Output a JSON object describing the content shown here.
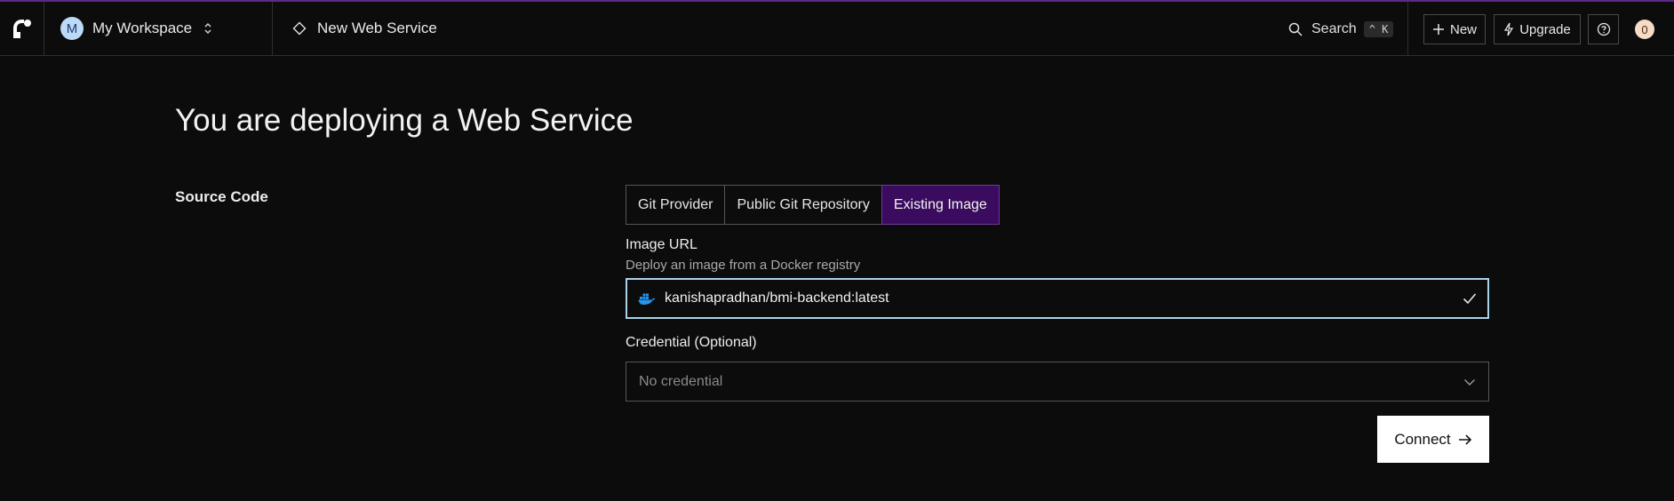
{
  "header": {
    "workspace_initial": "M",
    "workspace_name": "My Workspace",
    "breadcrumb": "New Web Service",
    "search_label": "Search",
    "search_shortcut": "^ K",
    "new_label": "New",
    "upgrade_label": "Upgrade",
    "notification_count": "0"
  },
  "main": {
    "title": "You are deploying a Web Service",
    "section_label": "Source Code",
    "tabs": [
      {
        "label": "Git Provider",
        "active": false
      },
      {
        "label": "Public Git Repository",
        "active": false
      },
      {
        "label": "Existing Image",
        "active": true
      }
    ],
    "image_url": {
      "label": "Image URL",
      "help": "Deploy an image from a Docker registry",
      "value": "kanishapradhan/bmi-backend:latest"
    },
    "credential": {
      "label": "Credential (Optional)",
      "selected": "No credential"
    },
    "connect_label": "Connect"
  },
  "colors": {
    "accent_purple": "#3a0b5e",
    "focus_border": "#a9d3ea",
    "docker_blue": "#2496ed",
    "avatar_bg": "#bcd9f6",
    "badge_bg": "#f6dcc4"
  },
  "icons": [
    "render-logo-icon",
    "chevron-updown-icon",
    "diamond-icon",
    "search-icon",
    "plus-icon",
    "lightning-icon",
    "help-icon",
    "docker-icon",
    "check-icon",
    "chevron-down-icon",
    "arrow-right-icon"
  ]
}
